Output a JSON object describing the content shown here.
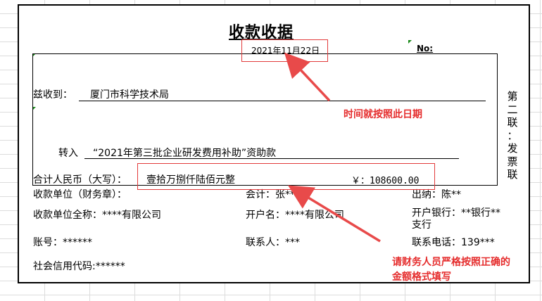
{
  "receipt": {
    "title": "收款收据",
    "date": "2021年11月22日",
    "no_label": "No:",
    "payer_label": "兹收到：",
    "payer": "厦门市科学技术局",
    "transfer_label": "转入",
    "transfer_desc": "“2021年第三批企业研发费用补助”资助款",
    "total_label": "合计人民币（大写）：",
    "total_upper": "壹拾万捌仟陆佰元整",
    "total_amount": "￥：108600.00",
    "copy_label": [
      "第",
      "二",
      "联",
      "：",
      "发",
      "票",
      "联"
    ],
    "unit_label": "收款单位（财务章）：",
    "accountant": "会计：张**",
    "cashier": "出纳：陈**",
    "unit_fullname": "收款单位全称：****有限公司",
    "account_name": "开户名：****有限公司",
    "bank": "开户银行：**银行**支行",
    "account_no": "账号：******",
    "contact": "联系人：***",
    "phone": "联系电话：139***",
    "credit_code": "社会信用代码:******"
  },
  "annotations": {
    "date_note": "时间就按照此日期",
    "amount_note_line1": "请财务人员严格按照正确的",
    "amount_note_line2": "金额格式填写",
    "color": "#e52d2d"
  }
}
